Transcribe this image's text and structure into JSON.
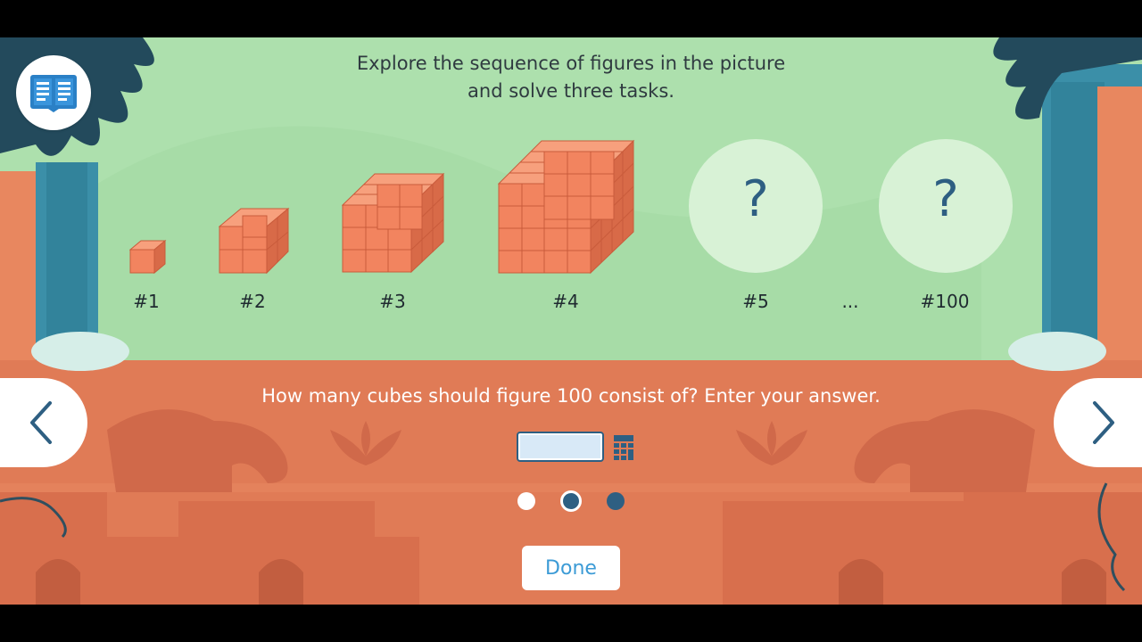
{
  "intro": {
    "line1": "Explore the sequence of figures in the picture",
    "line2": "and solve three tasks."
  },
  "figures": [
    {
      "label": "#1"
    },
    {
      "label": "#2"
    },
    {
      "label": "#3"
    },
    {
      "label": "#4"
    },
    {
      "label": "#5",
      "unknown": "?"
    },
    {
      "label": "..."
    },
    {
      "label": "#100",
      "unknown": "?"
    }
  ],
  "task": {
    "question": "How many cubes should figure 100 consist of? Enter your answer.",
    "answer_value": ""
  },
  "pagination": {
    "total": 3,
    "current": 2
  },
  "buttons": {
    "done": "Done"
  },
  "icons": {
    "book": "open-book-icon",
    "calculator": "calculator-icon",
    "prev": "chevron-left-icon",
    "next": "chevron-right-icon"
  },
  "colors": {
    "sky": "#ade0ad",
    "bottom_panel": "#e07b56",
    "cube": "#f2845f",
    "accent": "#2e5f82",
    "done_text": "#3c9bd6"
  }
}
